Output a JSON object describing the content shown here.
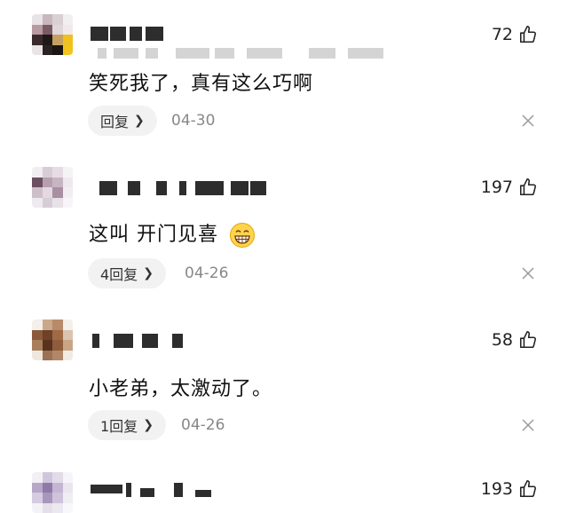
{
  "comments": [
    {
      "likes": "72",
      "text": "笑死我了，真有这么巧啊",
      "reply_label": "回复",
      "date": "04-30",
      "avatar_colors": [
        "#e8e3e6",
        "#c9b7bd",
        "#d9d0d4",
        "#f2eff1",
        "#b89aa3",
        "#7a5b63",
        "#e0d7da",
        "#f1e9ec",
        "#3a2a2d",
        "#1f1819",
        "#c5a060",
        "#f0c020",
        "#e9e4e7",
        "#2b2224",
        "#1b1516",
        "#f2c31a"
      ]
    },
    {
      "likes": "197",
      "text": "这叫 开门见喜",
      "reply_label": "4回复",
      "date": "04-26",
      "avatar_colors": [
        "#f1eef1",
        "#d8cdd6",
        "#e6dde4",
        "#f6f3f6",
        "#6b4f5f",
        "#b79fb0",
        "#c6b6c3",
        "#efe9ee",
        "#cdbfc9",
        "#e4d8e1",
        "#a98fa2",
        "#f2edf1",
        "#eeeaf0",
        "#d7cdd6",
        "#e8e2e8",
        "#f7f5f7"
      ]
    },
    {
      "likes": "58",
      "text": "小老弟，太激动了。",
      "reply_label": "1回复",
      "date": "04-26",
      "avatar_colors": [
        "#f3efea",
        "#c9a88a",
        "#b8896a",
        "#f4efe9",
        "#8b5a3c",
        "#6e4128",
        "#a06a45",
        "#d9c4b1",
        "#a87e5c",
        "#5a331e",
        "#8f5d3b",
        "#c7a585",
        "#efe7de",
        "#9b7253",
        "#b08867",
        "#f1ebe4"
      ]
    },
    {
      "likes": "193",
      "avatar_colors": [
        "#f2f0f4",
        "#d0c6db",
        "#e2dbe8",
        "#f6f4f8",
        "#b7a6c8",
        "#8e7aa5",
        "#c4b6d3",
        "#eae5ef",
        "#d6cce0",
        "#a897bb",
        "#cfc3dc",
        "#f0edf3",
        "#f4f2f6",
        "#e5dfea",
        "#ece8f0",
        "#f8f7f9"
      ]
    }
  ]
}
